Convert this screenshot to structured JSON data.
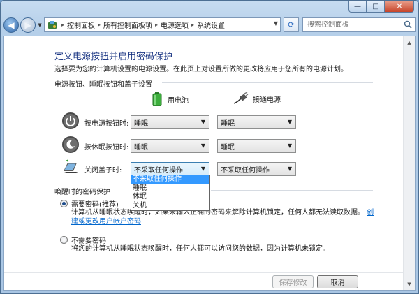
{
  "window": {
    "minimize_glyph": "—",
    "maximize_glyph": "□",
    "close_glyph": "✕"
  },
  "nav": {
    "back_glyph": "◀",
    "forward_glyph": "▶",
    "breadcrumbs": [
      "控制面板",
      "所有控制面板项",
      "电源选项",
      "系统设置"
    ],
    "search_placeholder": "搜索控制面板"
  },
  "page": {
    "title": "定义电源按钮并启用密码保护",
    "subtitle": "选择要为您的计算机设置的电源设置。在此页上对设置所做的更改将应用于您所有的电源计划。",
    "section_buttons": "电源按钮、睡眠按钮和盖子设置",
    "col_battery": "用电池",
    "col_plugged": "接通电源",
    "rows": [
      {
        "label": "按电源按钮时:",
        "battery": "睡眠",
        "plugged": "睡眠"
      },
      {
        "label": "按休眠按钮时:",
        "battery": "睡眠",
        "plugged": "睡眠"
      },
      {
        "label": "关闭盖子时:",
        "battery": "不采取任何操作",
        "plugged": "不采取任何操作"
      }
    ],
    "dropdown_options": [
      "不采取任何操作",
      "睡眠",
      "休眠",
      "关机"
    ],
    "section_password": "唤醒时的密码保护",
    "require_label": "需要密码(推荐)",
    "require_desc_1": "计算机从睡眠状态唤醒时，如果未输入正确的密码来解除计算机锁定，任何人都无法读取数据。",
    "require_link_1": "创",
    "require_link_2": "建或更改用户帐户密码",
    "norequire_label": "不需要密码",
    "norequire_desc": "将您的计算机从睡眠状态唤醒时，任何人都可以访问您的数据，因为计算机未锁定。",
    "save_button": "保存修改",
    "cancel_button": "取消"
  },
  "colors": {
    "title": "#1f3a86",
    "link": "#0066cc",
    "selection": "#3399ff"
  }
}
